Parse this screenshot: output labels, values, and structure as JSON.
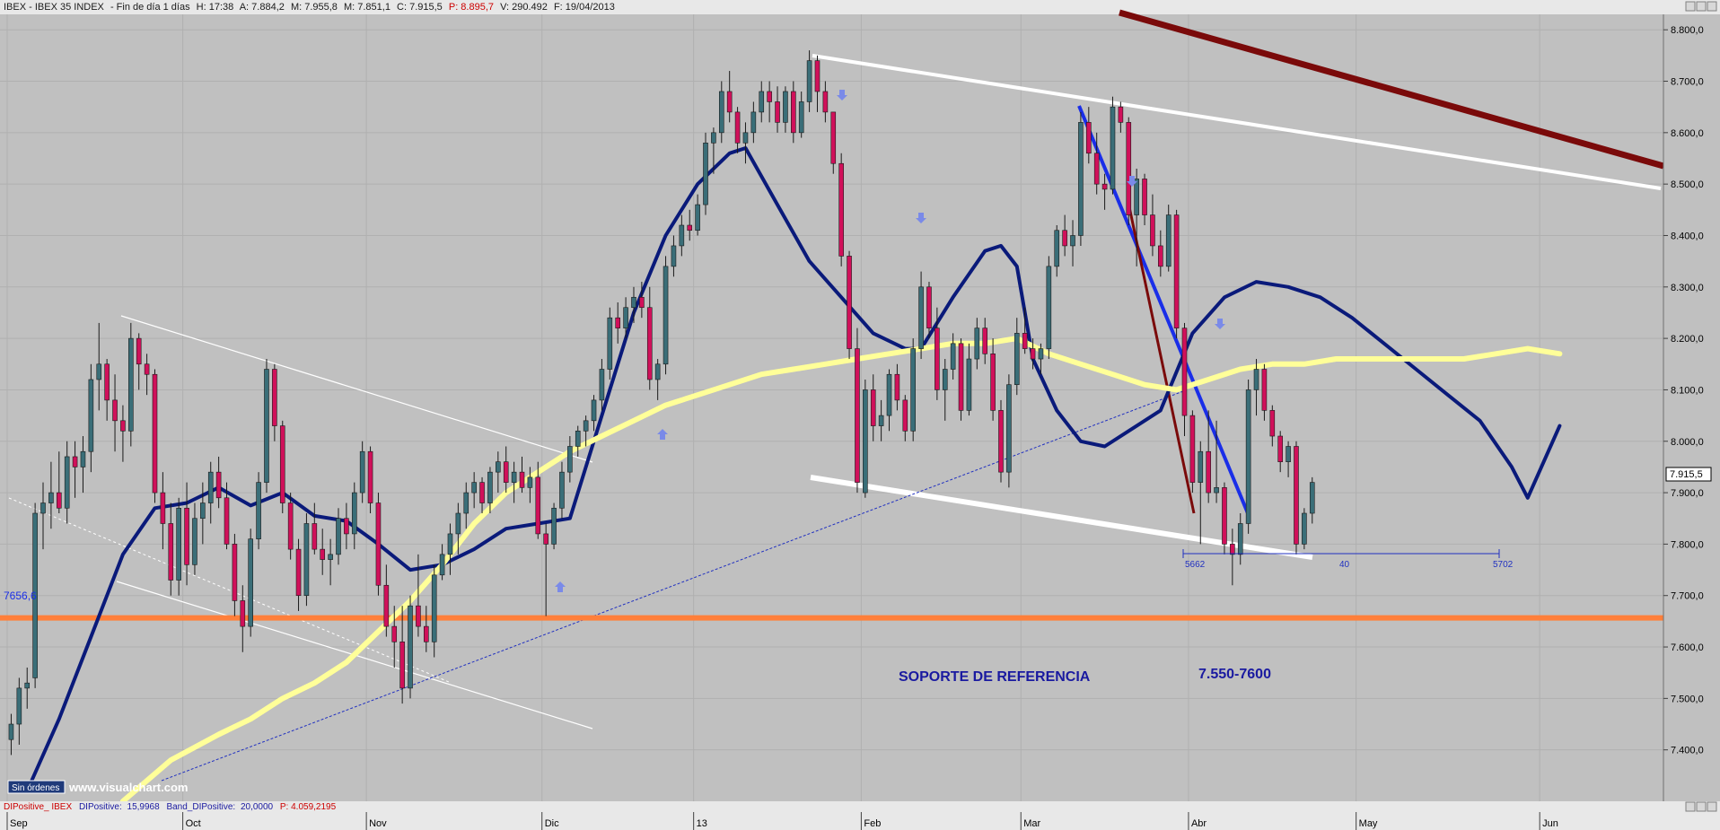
{
  "header": {
    "name": "IBEX - IBEX 35 INDEX",
    "period": "- Fin de día 1 días",
    "h": "H: 17:38",
    "a": "A: 7.884,2",
    "m": "M: 7.955,8",
    "mn": "M: 7.851,1",
    "c": "C: 7.915,5",
    "p": "P: 8.895,7",
    "v": "V: 290.492",
    "f": "F: 19/04/2013"
  },
  "footer": {
    "indicator": "DIPositive_ IBEX",
    "dip_label": "DIPositive:",
    "dip_value": "15,9968",
    "band_label": "Band_DIPositive:",
    "band_value": "20,0000",
    "p_value": "P: 4.059,2195"
  },
  "status": {
    "orders": "Sin órdenes",
    "watermark": "www.visualchart.com"
  },
  "annotations": {
    "support_text": "SOPORTE DE REFERENCIA",
    "support_range": "7.550-7600",
    "support_level_label": "7656,6",
    "last_price": "7.915,5",
    "measure_start": "5662",
    "measure_mid": "40",
    "measure_end": "5702"
  },
  "chart_data": {
    "type": "candlestick",
    "x_labels": [
      {
        "label": "Sep",
        "index": 0
      },
      {
        "label": "Oct",
        "index": 22
      },
      {
        "label": "Nov",
        "index": 45
      },
      {
        "label": "Dic",
        "index": 67
      },
      {
        "label": "13",
        "index": 86
      },
      {
        "label": "Feb",
        "index": 107
      },
      {
        "label": "Mar",
        "index": 127
      },
      {
        "label": "Abr",
        "index": 148
      },
      {
        "label": "May",
        "index": 169
      },
      {
        "label": "Jun",
        "index": 192
      }
    ],
    "y_ticks": [
      "7.400,0",
      "7.500,0",
      "7.600,0",
      "7.700,0",
      "7.800,0",
      "7.900,0",
      "8.000,0",
      "8.100,0",
      "8.200,0",
      "8.300,0",
      "8.400,0",
      "8.500,0",
      "8.600,0",
      "8.700,0",
      "8.800,0"
    ],
    "ylim": [
      7300,
      8830
    ],
    "xlim": [
      0,
      212
    ],
    "candles": [
      [
        7420,
        7470,
        7390,
        7450
      ],
      [
        7450,
        7540,
        7410,
        7520
      ],
      [
        7520,
        7560,
        7480,
        7530
      ],
      [
        7540,
        7880,
        7520,
        7860
      ],
      [
        7860,
        7920,
        7790,
        7880
      ],
      [
        7880,
        7960,
        7830,
        7900
      ],
      [
        7900,
        7980,
        7860,
        7870
      ],
      [
        7870,
        8000,
        7840,
        7970
      ],
      [
        7970,
        8000,
        7890,
        7950
      ],
      [
        7950,
        8010,
        7900,
        7980
      ],
      [
        7980,
        8150,
        7940,
        8120
      ],
      [
        8120,
        8230,
        8060,
        8150
      ],
      [
        8150,
        8160,
        8040,
        8080
      ],
      [
        8080,
        8130,
        7980,
        8040
      ],
      [
        8040,
        8070,
        7960,
        8020
      ],
      [
        8020,
        8230,
        7990,
        8200
      ],
      [
        8200,
        8210,
        8100,
        8150
      ],
      [
        8150,
        8170,
        8090,
        8130
      ],
      [
        8130,
        8140,
        7880,
        7900
      ],
      [
        7900,
        7940,
        7790,
        7840
      ],
      [
        7840,
        7880,
        7700,
        7730
      ],
      [
        7730,
        7890,
        7700,
        7870
      ],
      [
        7870,
        7920,
        7720,
        7760
      ],
      [
        7760,
        7880,
        7740,
        7850
      ],
      [
        7850,
        7920,
        7800,
        7880
      ],
      [
        7880,
        7960,
        7840,
        7940
      ],
      [
        7940,
        7970,
        7870,
        7890
      ],
      [
        7890,
        7920,
        7790,
        7800
      ],
      [
        7800,
        7820,
        7660,
        7690
      ],
      [
        7690,
        7720,
        7590,
        7640
      ],
      [
        7640,
        7830,
        7620,
        7810
      ],
      [
        7810,
        7940,
        7790,
        7920
      ],
      [
        7920,
        8160,
        7900,
        8140
      ],
      [
        8140,
        8150,
        8000,
        8030
      ],
      [
        8030,
        8040,
        7860,
        7880
      ],
      [
        7880,
        7900,
        7770,
        7790
      ],
      [
        7790,
        7810,
        7670,
        7700
      ],
      [
        7700,
        7860,
        7680,
        7840
      ],
      [
        7840,
        7880,
        7780,
        7790
      ],
      [
        7790,
        7830,
        7740,
        7770
      ],
      [
        7770,
        7810,
        7720,
        7780
      ],
      [
        7780,
        7870,
        7760,
        7850
      ],
      [
        7850,
        7880,
        7790,
        7820
      ],
      [
        7820,
        7920,
        7790,
        7900
      ],
      [
        7900,
        8000,
        7880,
        7980
      ],
      [
        7980,
        7990,
        7860,
        7880
      ],
      [
        7880,
        7900,
        7700,
        7720
      ],
      [
        7720,
        7760,
        7620,
        7640
      ],
      [
        7640,
        7680,
        7560,
        7610
      ],
      [
        7610,
        7680,
        7490,
        7520
      ],
      [
        7520,
        7700,
        7500,
        7680
      ],
      [
        7680,
        7780,
        7620,
        7640
      ],
      [
        7640,
        7680,
        7590,
        7610
      ],
      [
        7610,
        7760,
        7580,
        7740
      ],
      [
        7740,
        7800,
        7730,
        7780
      ],
      [
        7780,
        7840,
        7740,
        7820
      ],
      [
        7820,
        7880,
        7780,
        7860
      ],
      [
        7860,
        7920,
        7830,
        7900
      ],
      [
        7900,
        7940,
        7870,
        7920
      ],
      [
        7920,
        7930,
        7860,
        7880
      ],
      [
        7880,
        7950,
        7860,
        7940
      ],
      [
        7940,
        7980,
        7900,
        7960
      ],
      [
        7960,
        7990,
        7900,
        7920
      ],
      [
        7920,
        7960,
        7880,
        7940
      ],
      [
        7940,
        7970,
        7900,
        7910
      ],
      [
        7910,
        7950,
        7880,
        7930
      ],
      [
        7930,
        7960,
        7810,
        7820
      ],
      [
        7820,
        7840,
        7660,
        7800
      ],
      [
        7800,
        7880,
        7790,
        7870
      ],
      [
        7870,
        7960,
        7850,
        7940
      ],
      [
        7940,
        8010,
        7920,
        7990
      ],
      [
        7990,
        8030,
        7970,
        8020
      ],
      [
        8020,
        8050,
        7990,
        8040
      ],
      [
        8040,
        8090,
        8020,
        8080
      ],
      [
        8080,
        8160,
        8060,
        8140
      ],
      [
        8140,
        8260,
        8120,
        8240
      ],
      [
        8240,
        8270,
        8190,
        8220
      ],
      [
        8220,
        8280,
        8200,
        8260
      ],
      [
        8260,
        8300,
        8230,
        8280
      ],
      [
        8280,
        8310,
        8240,
        8260
      ],
      [
        8260,
        8300,
        8100,
        8120
      ],
      [
        8120,
        8160,
        8080,
        8150
      ],
      [
        8150,
        8360,
        8130,
        8340
      ],
      [
        8340,
        8400,
        8320,
        8380
      ],
      [
        8380,
        8440,
        8360,
        8420
      ],
      [
        8420,
        8450,
        8390,
        8410
      ],
      [
        8410,
        8480,
        8400,
        8460
      ],
      [
        8460,
        8600,
        8440,
        8580
      ],
      [
        8580,
        8610,
        8520,
        8600
      ],
      [
        8600,
        8700,
        8580,
        8680
      ],
      [
        8680,
        8720,
        8620,
        8640
      ],
      [
        8640,
        8650,
        8560,
        8580
      ],
      [
        8580,
        8620,
        8540,
        8600
      ],
      [
        8600,
        8660,
        8580,
        8640
      ],
      [
        8640,
        8700,
        8620,
        8680
      ],
      [
        8680,
        8700,
        8620,
        8660
      ],
      [
        8660,
        8690,
        8600,
        8620
      ],
      [
        8620,
        8690,
        8600,
        8680
      ],
      [
        8680,
        8700,
        8580,
        8600
      ],
      [
        8600,
        8680,
        8590,
        8660
      ],
      [
        8660,
        8760,
        8640,
        8740
      ],
      [
        8740,
        8750,
        8640,
        8680
      ],
      [
        8680,
        8700,
        8620,
        8640
      ],
      [
        8640,
        8640,
        8520,
        8540
      ],
      [
        8540,
        8560,
        8340,
        8360
      ],
      [
        8360,
        8370,
        8160,
        8180
      ],
      [
        8180,
        8220,
        7900,
        7920
      ],
      [
        7900,
        8120,
        7890,
        8100
      ],
      [
        8100,
        8130,
        8000,
        8030
      ],
      [
        8030,
        8080,
        8000,
        8050
      ],
      [
        8050,
        8140,
        8020,
        8130
      ],
      [
        8130,
        8150,
        8060,
        8080
      ],
      [
        8080,
        8090,
        8000,
        8020
      ],
      [
        8020,
        8200,
        8000,
        8180
      ],
      [
        8180,
        8330,
        8160,
        8300
      ],
      [
        8300,
        8310,
        8200,
        8220
      ],
      [
        8220,
        8260,
        8080,
        8100
      ],
      [
        8100,
        8160,
        8040,
        8140
      ],
      [
        8140,
        8210,
        8120,
        8190
      ],
      [
        8190,
        8200,
        8040,
        8060
      ],
      [
        8060,
        8190,
        8050,
        8160
      ],
      [
        8160,
        8240,
        8140,
        8220
      ],
      [
        8220,
        8240,
        8150,
        8170
      ],
      [
        8170,
        8200,
        8040,
        8060
      ],
      [
        8060,
        8080,
        7920,
        7940
      ],
      [
        7940,
        8130,
        7910,
        8110
      ],
      [
        8110,
        8240,
        8090,
        8210
      ],
      [
        8210,
        8260,
        8170,
        8180
      ],
      [
        8180,
        8200,
        8140,
        8160
      ],
      [
        8160,
        8190,
        8130,
        8180
      ],
      [
        8180,
        8360,
        8160,
        8340
      ],
      [
        8340,
        8420,
        8320,
        8410
      ],
      [
        8410,
        8440,
        8360,
        8380
      ],
      [
        8380,
        8430,
        8340,
        8400
      ],
      [
        8400,
        8640,
        8380,
        8620
      ],
      [
        8620,
        8650,
        8540,
        8560
      ],
      [
        8560,
        8600,
        8480,
        8500
      ],
      [
        8500,
        8520,
        8450,
        8490
      ],
      [
        8490,
        8670,
        8480,
        8650
      ],
      [
        8650,
        8660,
        8600,
        8620
      ],
      [
        8620,
        8630,
        8420,
        8440
      ],
      [
        8440,
        8530,
        8340,
        8510
      ],
      [
        8510,
        8520,
        8420,
        8440
      ],
      [
        8440,
        8480,
        8360,
        8380
      ],
      [
        8380,
        8410,
        8320,
        8340
      ],
      [
        8340,
        8460,
        8330,
        8440
      ],
      [
        8440,
        8450,
        8200,
        8220
      ],
      [
        8220,
        8230,
        8010,
        8050
      ],
      [
        8050,
        8060,
        7900,
        7920
      ],
      [
        7920,
        8000,
        7800,
        7980
      ],
      [
        7980,
        8060,
        7880,
        7900
      ],
      [
        7900,
        8040,
        7880,
        7910
      ],
      [
        7910,
        7920,
        7780,
        7800
      ],
      [
        7800,
        7830,
        7720,
        7780
      ],
      [
        7780,
        7860,
        7760,
        7840
      ],
      [
        7840,
        8120,
        7820,
        8100
      ],
      [
        8100,
        8160,
        8050,
        8140
      ],
      [
        8140,
        8150,
        8040,
        8060
      ],
      [
        8060,
        8070,
        7990,
        8010
      ],
      [
        8010,
        8020,
        7940,
        7960
      ],
      [
        7960,
        8000,
        7930,
        7990
      ],
      [
        7990,
        8000,
        7780,
        7800
      ],
      [
        7800,
        7870,
        7790,
        7860
      ],
      [
        7860,
        7930,
        7840,
        7920
      ]
    ],
    "moving_averages": [
      {
        "name": "",
        "color": "#0a1a7a",
        "points": [
          [
            2,
            7320
          ],
          [
            6,
            7460
          ],
          [
            10,
            7620
          ],
          [
            14,
            7780
          ],
          [
            18,
            7870
          ],
          [
            22,
            7880
          ],
          [
            26,
            7910
          ],
          [
            30,
            7875
          ],
          [
            34,
            7900
          ],
          [
            38,
            7855
          ],
          [
            42,
            7845
          ],
          [
            46,
            7800
          ],
          [
            50,
            7750
          ],
          [
            54,
            7760
          ],
          [
            58,
            7790
          ],
          [
            62,
            7830
          ],
          [
            66,
            7840
          ],
          [
            70,
            7850
          ],
          [
            74,
            8050
          ],
          [
            78,
            8250
          ],
          [
            82,
            8400
          ],
          [
            86,
            8500
          ],
          [
            90,
            8560
          ],
          [
            92,
            8570
          ],
          [
            96,
            8460
          ],
          [
            100,
            8350
          ],
          [
            104,
            8280
          ],
          [
            108,
            8210
          ],
          [
            112,
            8180
          ],
          [
            114,
            8180
          ],
          [
            118,
            8280
          ],
          [
            122,
            8370
          ],
          [
            124,
            8380
          ],
          [
            126,
            8340
          ],
          [
            128,
            8160
          ],
          [
            131,
            8060
          ],
          [
            134,
            8000
          ],
          [
            137,
            7990
          ],
          [
            140,
            8020
          ],
          [
            144,
            8060
          ],
          [
            148,
            8210
          ],
          [
            152,
            8280
          ],
          [
            156,
            8310
          ],
          [
            160,
            8300
          ],
          [
            164,
            8280
          ],
          [
            168,
            8240
          ],
          [
            172,
            8190
          ],
          [
            176,
            8140
          ],
          [
            180,
            8090
          ],
          [
            184,
            8040
          ],
          [
            188,
            7950
          ],
          [
            190,
            7890
          ],
          [
            194,
            8030
          ]
        ]
      },
      {
        "name": "",
        "color": "#ffff99",
        "points": [
          [
            14,
            7300
          ],
          [
            20,
            7380
          ],
          [
            26,
            7430
          ],
          [
            30,
            7460
          ],
          [
            34,
            7500
          ],
          [
            38,
            7530
          ],
          [
            42,
            7570
          ],
          [
            46,
            7630
          ],
          [
            50,
            7690
          ],
          [
            54,
            7760
          ],
          [
            58,
            7840
          ],
          [
            62,
            7900
          ],
          [
            66,
            7940
          ],
          [
            70,
            7980
          ],
          [
            74,
            8010
          ],
          [
            78,
            8040
          ],
          [
            82,
            8070
          ],
          [
            86,
            8090
          ],
          [
            90,
            8110
          ],
          [
            94,
            8130
          ],
          [
            98,
            8140
          ],
          [
            102,
            8150
          ],
          [
            106,
            8160
          ],
          [
            110,
            8170
          ],
          [
            114,
            8180
          ],
          [
            118,
            8190
          ],
          [
            122,
            8190
          ],
          [
            126,
            8200
          ],
          [
            130,
            8170
          ],
          [
            134,
            8150
          ],
          [
            138,
            8130
          ],
          [
            142,
            8110
          ],
          [
            146,
            8100
          ],
          [
            150,
            8120
          ],
          [
            154,
            8140
          ],
          [
            158,
            8150
          ],
          [
            162,
            8150
          ],
          [
            166,
            8160
          ],
          [
            170,
            8160
          ],
          [
            174,
            8160
          ],
          [
            178,
            8160
          ],
          [
            182,
            8160
          ],
          [
            186,
            8170
          ],
          [
            190,
            8180
          ],
          [
            194,
            8170
          ]
        ]
      }
    ],
    "annotation_levels": {
      "support": 7656.6,
      "last": 7915.5
    }
  }
}
